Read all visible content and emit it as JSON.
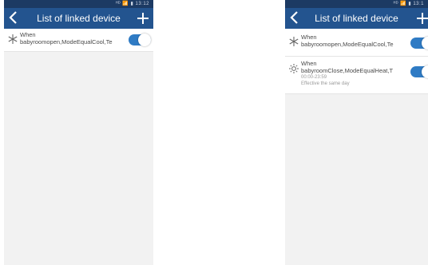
{
  "left": {
    "status": "⁠ᴴᴰ 📶 ▮ 13:12",
    "appbar": {
      "back_icon": "chevron-left-icon",
      "title": "List of linked device",
      "add_icon": "plus-icon"
    },
    "items": [
      {
        "icon": "snowflake-icon",
        "when": "When",
        "rule": "babyroomopen,ModeEqualCool,Te",
        "enabled": true
      }
    ]
  },
  "right": {
    "status": "ᴴᴰ 📶 ▮ 13:1",
    "appbar": {
      "back_icon": "chevron-left-icon",
      "title": "List of linked device",
      "add_icon": "plus-icon"
    },
    "items": [
      {
        "icon": "snowflake-icon",
        "when": "When",
        "rule": "babyroomopen,ModeEqualCool,Te",
        "enabled": true
      },
      {
        "icon": "sun-icon",
        "when": "When",
        "rule": "babyroomClose,ModeEqualHeat,T",
        "time": "00:00-23:59",
        "repeat": "Effective the same day",
        "enabled": true
      }
    ]
  }
}
